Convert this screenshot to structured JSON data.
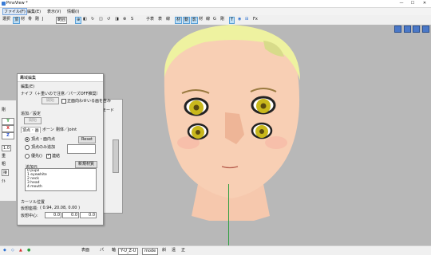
{
  "window": {
    "title": "PmxView *",
    "controls": [
      "—",
      "☐",
      "✕"
    ]
  },
  "menubar": {
    "items": [
      "ファイル(F)",
      "編集(E)",
      "表示(V)",
      "情報(I)"
    ]
  },
  "toolbar": {
    "left": [
      "選択",
      "頂",
      "材",
      "骨",
      "剛",
      "J"
    ],
    "range_label": "範囲",
    "tools": [
      "⊕",
      "◧",
      "↻",
      "◫",
      "↺",
      "◨",
      "⊗",
      "S"
    ],
    "right_labels": [
      "子表",
      "表",
      "線",
      "材",
      "動",
      "影",
      "材",
      "線",
      "G",
      "剛",
      "T",
      "Fx"
    ]
  },
  "statusbar": {
    "items": [
      "表面",
      "パ",
      "軸",
      "Y-U_Z-U",
      "mode",
      "斜",
      "遠",
      "正"
    ],
    "mode_value": "mode"
  },
  "left_panel": {
    "items": [
      "剛",
      "Y",
      "X",
      "Z",
      "1.0",
      "重",
      "粗",
      "接",
      "ｸﾄ"
    ]
  },
  "back_window": {
    "label": "ｰ",
    "mode_label": "あモード"
  },
  "dialog": {
    "title": "局域編集",
    "header": "編集(E)",
    "knife_label": "ナイフ（＋重いので注意／パーズOFF推奨）",
    "knife_button": "開始",
    "show_unlisted_label": "正面向わせいる画を含み",
    "add_section": "追加／設定",
    "add_button": "開始",
    "tabs": [
      "頂点 ･ 画",
      "ボーン",
      "剛体／Joint"
    ],
    "radios": [
      "頂点・面内点",
      "頂点のみ追加",
      "優先()"
    ],
    "reset_button": "Reset",
    "link_label": "連結",
    "new_button": "新規材質",
    "list_header": "追加元",
    "list_items": [
      "0  pupil",
      "1  eyewhite",
      "2  neck",
      "3  head",
      "4  mouth"
    ],
    "cursor_section": "カーソル位置",
    "pos_label": "仮想座標:",
    "pos_value": "( 0.94, 20.08, 0.00 )",
    "center_label": "仮想中心:",
    "center_values": [
      "0.0",
      "0.0",
      "0.0"
    ]
  },
  "colors": {
    "viewport": "#b8b8b8",
    "axis_y": "#2e9e3e",
    "skin": "#f8cfb4",
    "hair": "#eef2a0",
    "iris": "#c9b81c"
  }
}
